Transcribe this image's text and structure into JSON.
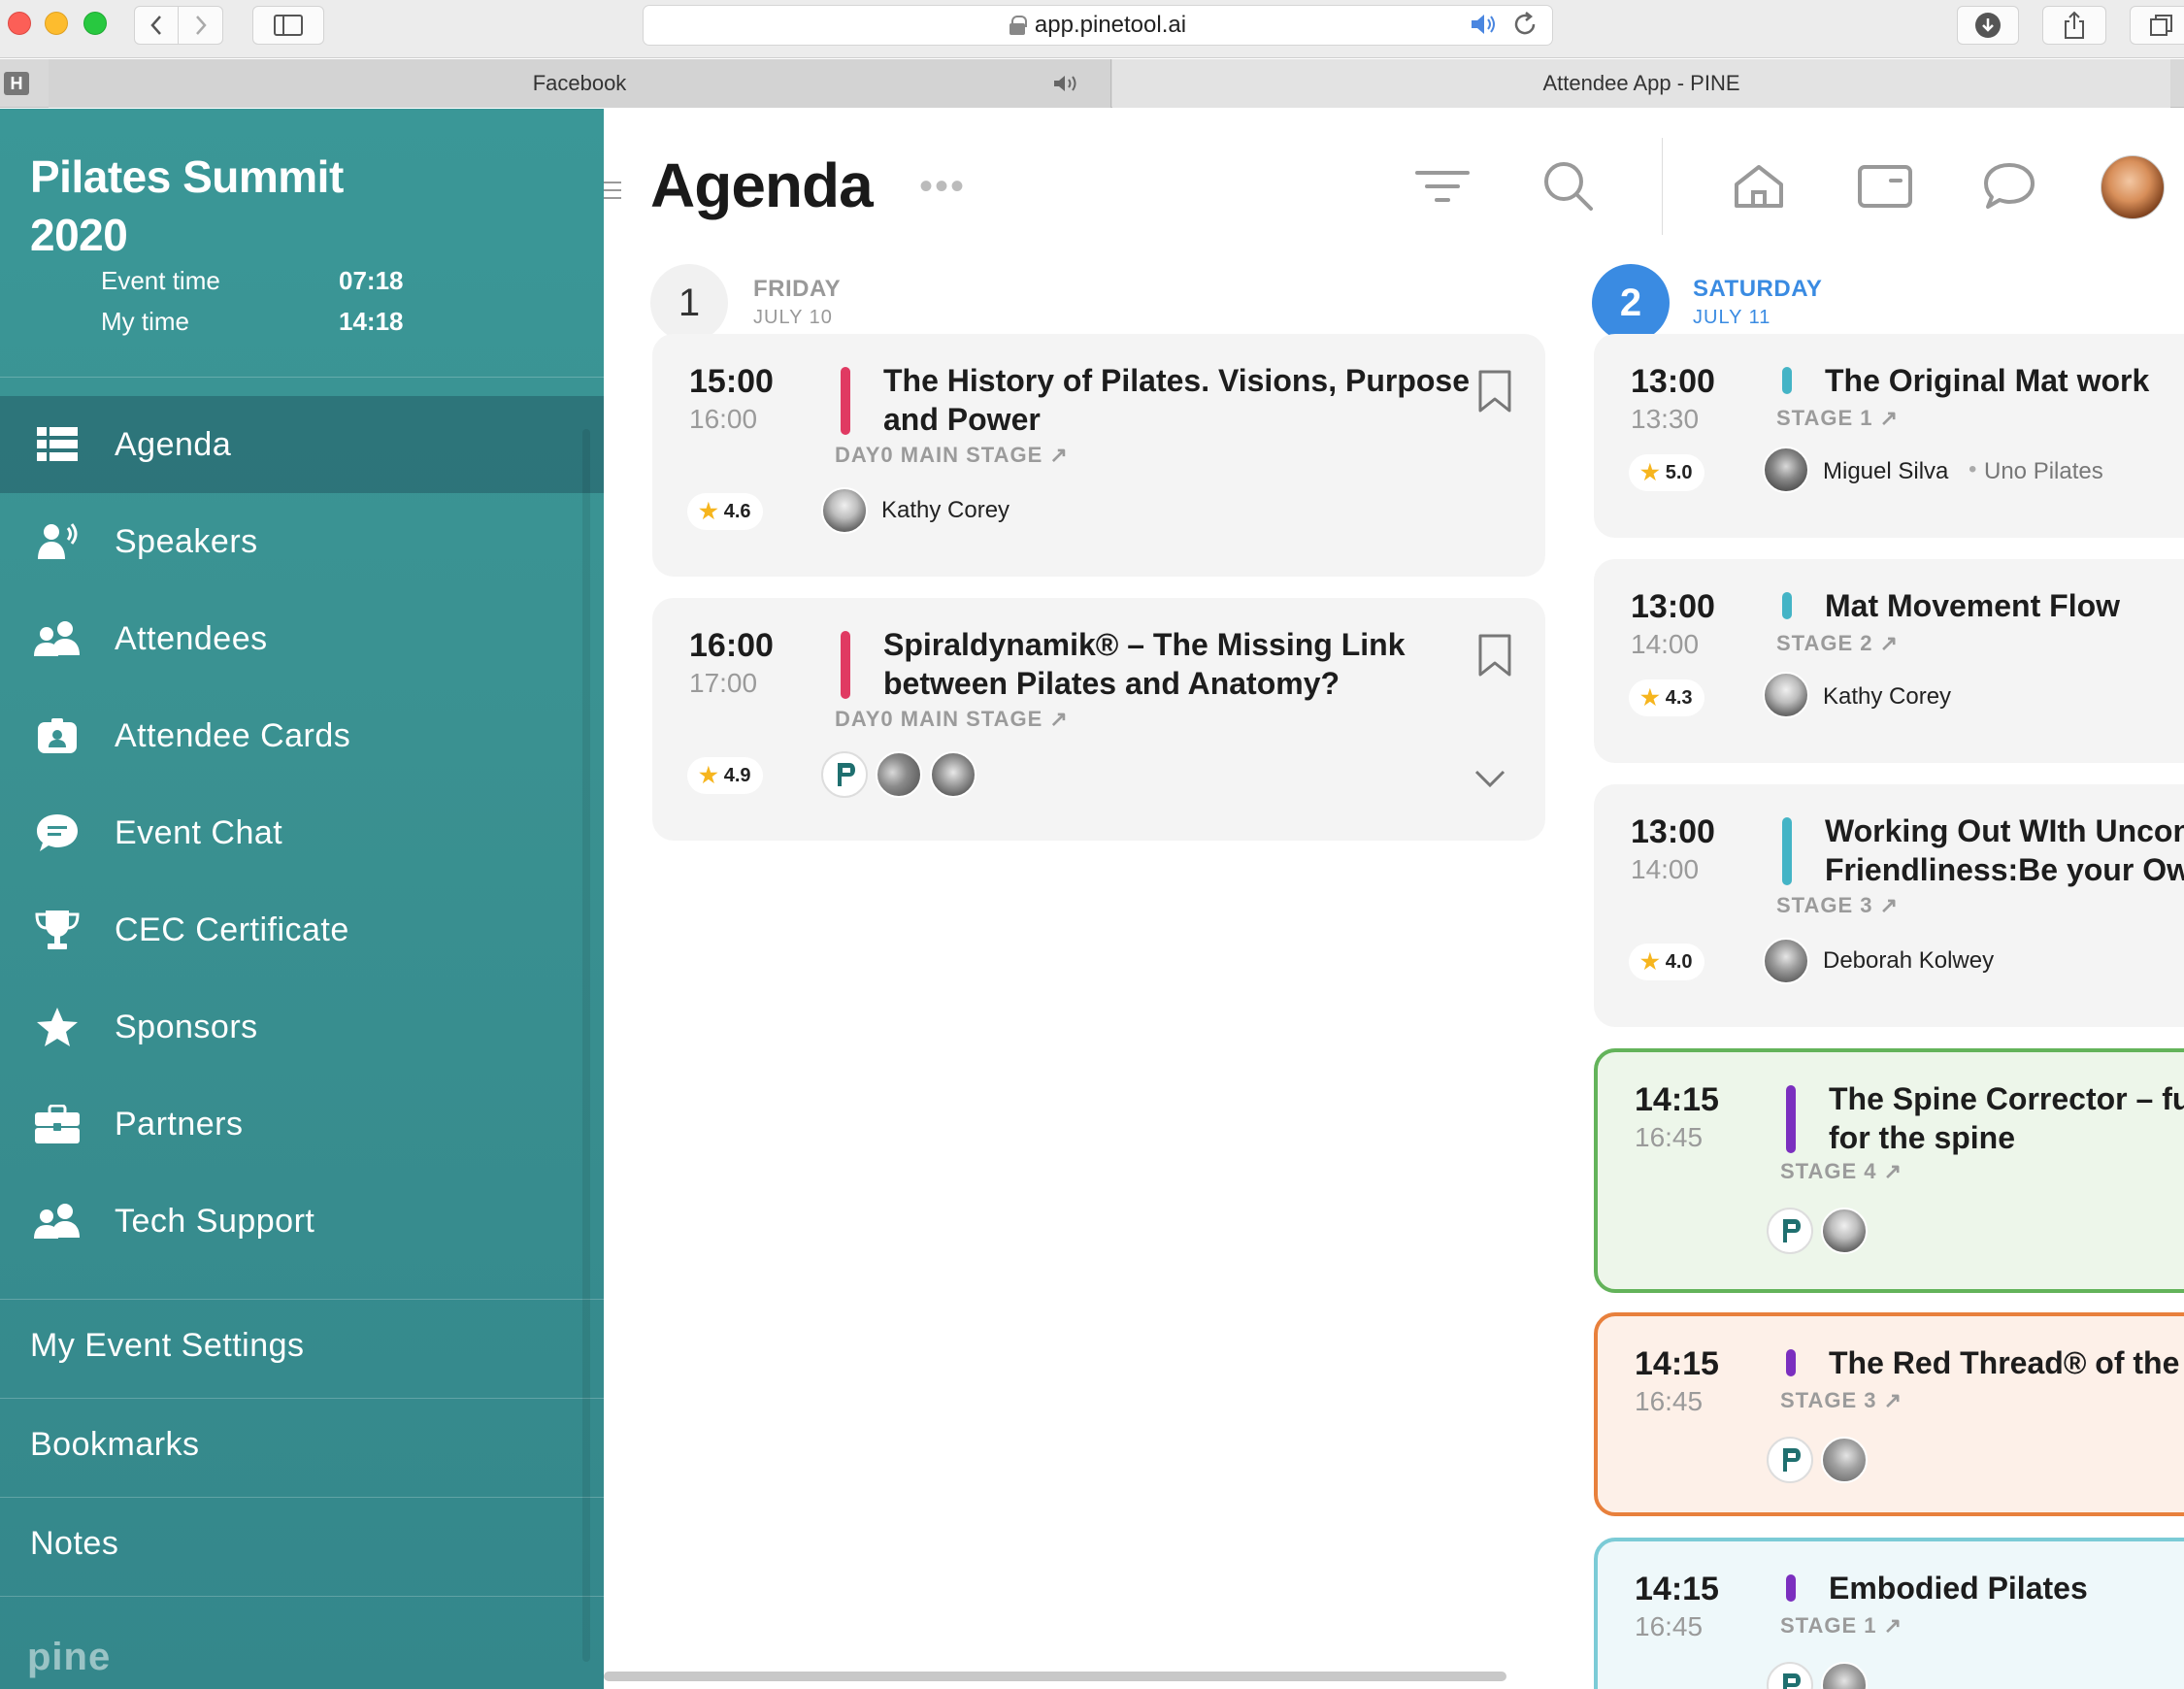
{
  "browser": {
    "url": "app.pinetool.ai",
    "tabs": [
      {
        "label": "Facebook",
        "audio": true
      },
      {
        "label": "Attendee App - PINE",
        "active": true
      }
    ],
    "tab_badge": "H"
  },
  "sidebar": {
    "event_title_line1": "Pilates Summit",
    "event_title_line2": "2020",
    "event_time_label": "Event time",
    "event_time_value": "07:18",
    "my_time_label": "My time",
    "my_time_value": "14:18",
    "items": [
      {
        "label": "Agenda",
        "icon": "list-icon",
        "active": true
      },
      {
        "label": "Speakers",
        "icon": "speaker-icon"
      },
      {
        "label": "Attendees",
        "icon": "people-icon"
      },
      {
        "label": "Attendee Cards",
        "icon": "id-card-icon"
      },
      {
        "label": "Event Chat",
        "icon": "chat-icon"
      },
      {
        "label": "CEC Certificate",
        "icon": "trophy-icon"
      },
      {
        "label": "Sponsors",
        "icon": "star-icon"
      },
      {
        "label": "Partners",
        "icon": "briefcase-icon"
      },
      {
        "label": "Tech Support",
        "icon": "people-icon"
      }
    ],
    "bottom_items": [
      "My Event Settings",
      "Bookmarks",
      "Notes"
    ],
    "logo": "pine"
  },
  "header": {
    "title": "Agenda",
    "more": "•••"
  },
  "days": [
    {
      "number": "1",
      "name": "FRIDAY",
      "date": "JULY 10"
    },
    {
      "number": "2",
      "name": "SATURDAY",
      "date": "JULY 11"
    }
  ],
  "day1_sessions": [
    {
      "start": "15:00",
      "end": "16:00",
      "title_line1": "The History of Pilates. Visions, Purpose",
      "title_line2": "and Power",
      "stage": "DAY0 MAIN STAGE ↗",
      "rating": "4.6",
      "speaker": "Kathy Corey",
      "color": "#e03a62"
    },
    {
      "start": "16:00",
      "end": "17:00",
      "title_line1": "Spiraldynamik® – The Missing Link",
      "title_line2": "between Pilates and Anatomy?",
      "stage": "DAY0 MAIN STAGE ↗",
      "rating": "4.9",
      "color": "#e03a62"
    }
  ],
  "day2_sessions": [
    {
      "start": "13:00",
      "end": "13:30",
      "title_line1": "The Original Mat work",
      "stage": "STAGE 1 ↗",
      "rating": "5.0",
      "speaker": "Miguel Silva",
      "company": "Uno Pilates",
      "color": "#44b4c6"
    },
    {
      "start": "13:00",
      "end": "14:00",
      "title_line1": "Mat Movement Flow",
      "stage": "STAGE 2 ↗",
      "rating": "4.3",
      "speaker": "Kathy Corey",
      "color": "#44b4c6"
    },
    {
      "start": "13:00",
      "end": "14:00",
      "title_line1": "Working Out WIth Uncond",
      "title_line2": "Friendliness:Be your Own",
      "stage": "STAGE 3 ↗",
      "rating": "4.0",
      "speaker": "Deborah Kolwey",
      "color": "#44b4c6"
    },
    {
      "start": "14:15",
      "end": "16:45",
      "title_line1": "The Spine Corrector – fun",
      "title_line2": "for the spine",
      "stage": "STAGE 4 ↗",
      "color": "#7b2fbf",
      "border": "#63b35a"
    },
    {
      "start": "14:15",
      "end": "16:45",
      "title_line1": "The Red Thread® of the Hu",
      "stage": "STAGE 3 ↗",
      "color": "#7b2fbf",
      "border": "#e8803c"
    },
    {
      "start": "14:15",
      "end": "16:45",
      "title_line1": "Embodied Pilates",
      "stage": "STAGE 1 ↗",
      "color": "#7b2fbf",
      "border": "#7bcbd6"
    }
  ]
}
